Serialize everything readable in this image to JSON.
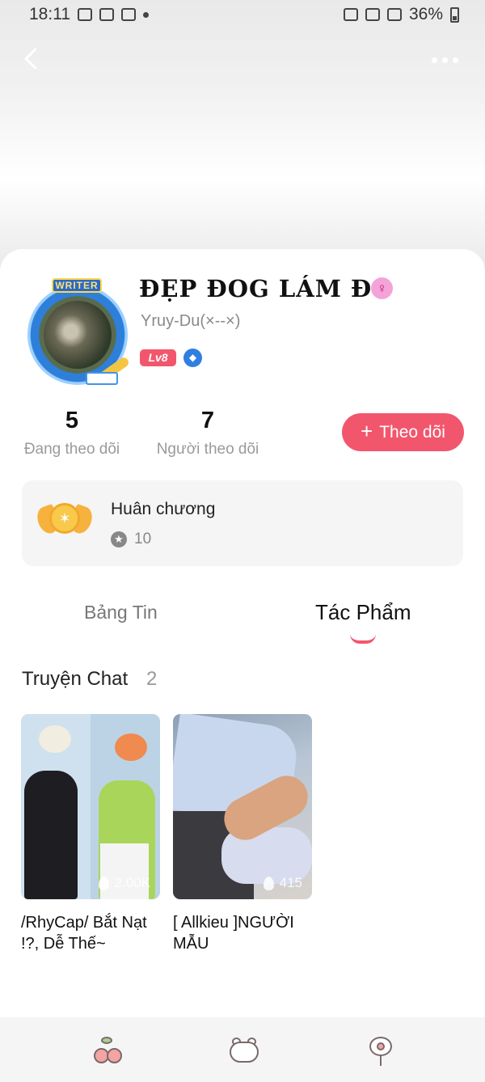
{
  "status_bar": {
    "time": "18:11",
    "battery": "36%"
  },
  "profile": {
    "avatar_badge": "WRITER",
    "name": "ĐẸP ĐOG LÁM ĐO",
    "gender_symbol": "♀",
    "handle": "Yruy-Du(×--×)",
    "level": "Lv8",
    "stats": {
      "following_count": "5",
      "following_label": "Đang theo dõi",
      "followers_count": "7",
      "followers_label": "Người theo dõi"
    },
    "follow_button": "Theo dõi"
  },
  "medals": {
    "title": "Huân chương",
    "count": "10"
  },
  "tabs": {
    "feed": "Bảng Tin",
    "works": "Tác Phẩm",
    "active": "works"
  },
  "section": {
    "title": "Truyện Chat",
    "count": "2"
  },
  "stories": [
    {
      "title": "/RhyCap/ Bắt Nạt !?, Dễ Thế~",
      "views": "2.00K"
    },
    {
      "title": "[ Allkieu ]NGƯỜI MẪU",
      "views": "415"
    }
  ],
  "colors": {
    "accent": "#f2566d",
    "medal_box": "#f5f5f5",
    "nav_bg": "#f5f5f5"
  },
  "icons": {
    "nav": [
      "cherry-icon",
      "bear-icon",
      "flower-icon"
    ]
  }
}
